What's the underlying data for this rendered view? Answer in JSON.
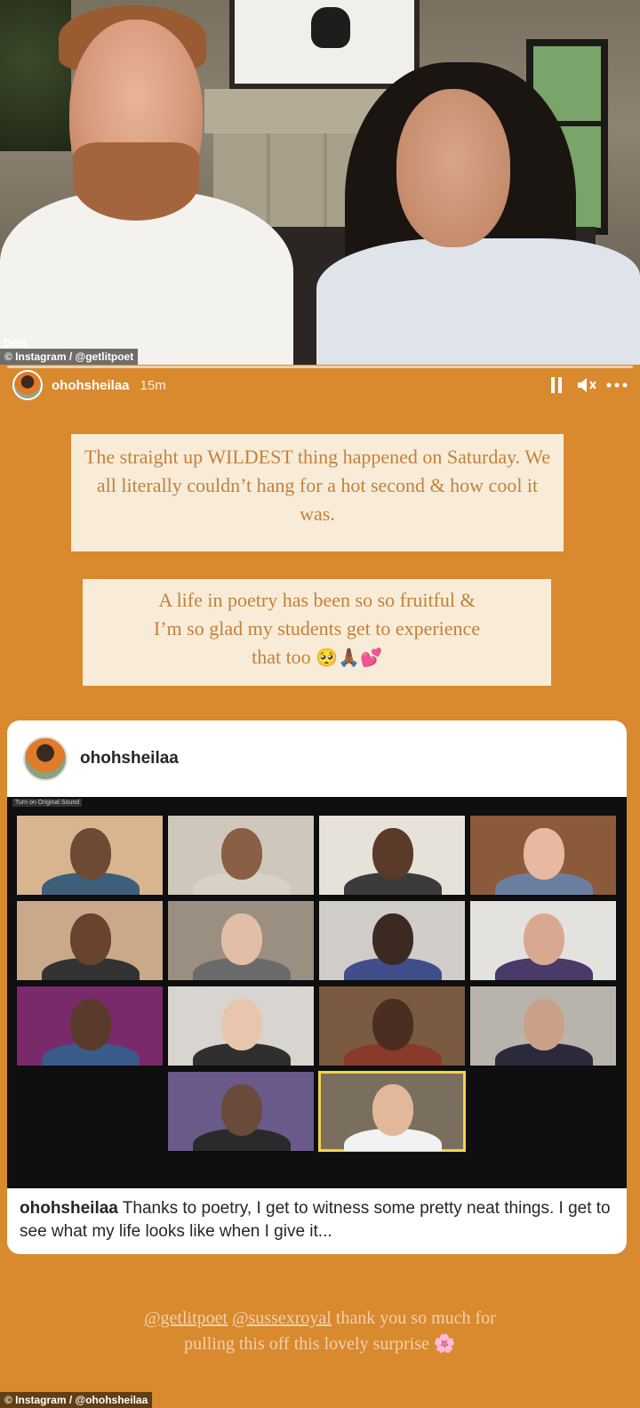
{
  "photo_top": {
    "watermark": "© Instagram / @getlitpoet",
    "badge": "DoS"
  },
  "story": {
    "username": "ohohsheilaa",
    "time": "15m",
    "icons": [
      "pause-icon",
      "mute-icon",
      "more-icon"
    ],
    "text_box_1": "The straight up WILDEST thing happened on Saturday. We all literally couldn’t hang for a hot second & how cool it was.",
    "text_box_2_lines": [
      "A life in poetry has been so so fruitful &",
      "I’m so glad my students get to experience",
      "that too"
    ],
    "text_box_2_emoji": "🥺🙏🏾💕"
  },
  "post": {
    "username": "ohohsheilaa",
    "zoom_bar_label": "Turn on Original Sound",
    "caption_user": "ohohsheilaa",
    "caption_text": " Thanks to poetry, I get to witness some pretty neat things. I get to see what my life looks like when I give it..."
  },
  "bottom": {
    "mention_1": "@getlitpoet",
    "mention_2": "@sussexroyal",
    "text_after": " thank you so much for pulling this off this lovely surprise",
    "emoji": "🌸",
    "watermark": "© Instagram / @ohohsheilaa"
  },
  "colors": {
    "story_background": "#d9892e",
    "text_box_background": "#f8ecd8",
    "text_box_color": "#c2813b"
  }
}
